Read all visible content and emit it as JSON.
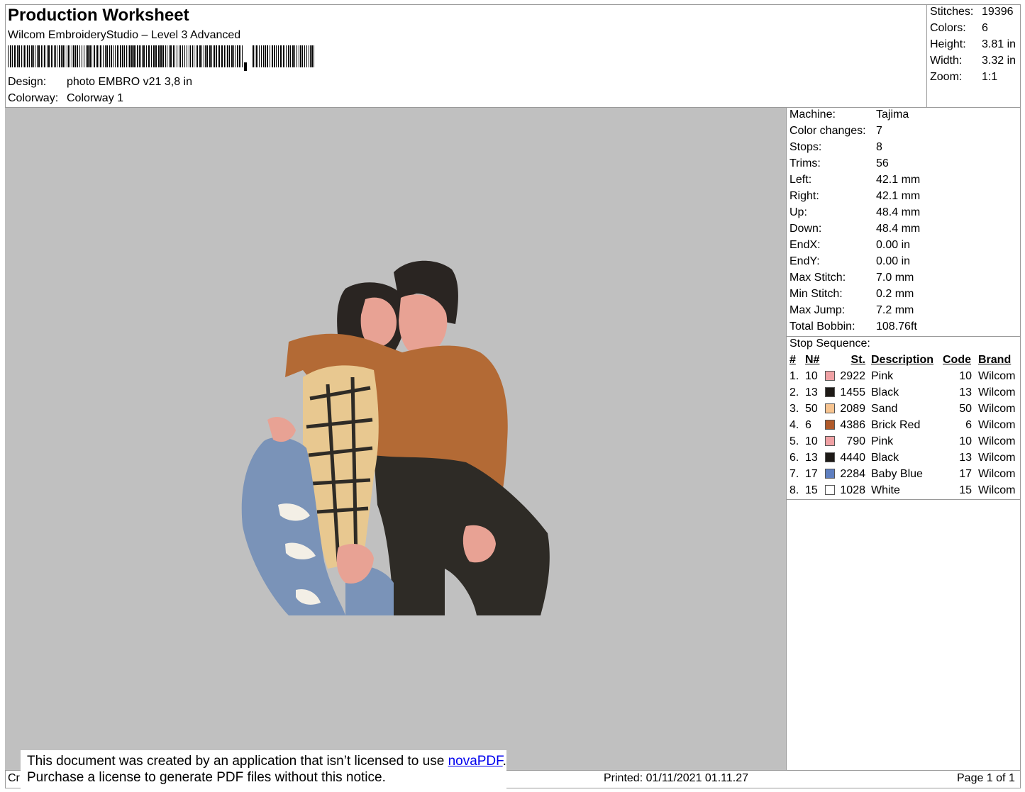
{
  "header": {
    "title": "Production Worksheet",
    "subtitle": "Wilcom EmbroideryStudio – Level 3 Advanced",
    "barcode_icon": "barcode-icon",
    "design_label": "Design:",
    "design_value": "photo EMBRO v21 3,8 in",
    "colorway_label": "Colorway:",
    "colorway_value": "Colorway 1"
  },
  "stats": [
    {
      "label": "Stitches:",
      "value": "19396"
    },
    {
      "label": "Colors:",
      "value": "6"
    },
    {
      "label": "Height:",
      "value": "3.81 in"
    },
    {
      "label": "Width:",
      "value": "3.32 in"
    },
    {
      "label": "Zoom:",
      "value": "1:1"
    }
  ],
  "machine_info": [
    {
      "label": "Machine:",
      "value": "Tajima"
    },
    {
      "label": "Color changes:",
      "value": "7"
    },
    {
      "label": "Stops:",
      "value": "8"
    },
    {
      "label": "Trims:",
      "value": "56"
    },
    {
      "label": "Left:",
      "value": "42.1 mm"
    },
    {
      "label": "Right:",
      "value": "42.1 mm"
    },
    {
      "label": "Up:",
      "value": "48.4 mm"
    },
    {
      "label": "Down:",
      "value": "48.4 mm"
    },
    {
      "label": "EndX:",
      "value": "0.00 in"
    },
    {
      "label": "EndY:",
      "value": "0.00 in"
    },
    {
      "label": "Max Stitch:",
      "value": "7.0 mm"
    },
    {
      "label": "Min Stitch:",
      "value": "0.2 mm"
    },
    {
      "label": "Max Jump:",
      "value": "7.2 mm"
    },
    {
      "label": "Total Bobbin:",
      "value": "108.76ft"
    }
  ],
  "stop_sequence": {
    "title": "Stop Sequence:",
    "headers": {
      "num": "#",
      "n": "N#",
      "st": "St.",
      "description": "Description",
      "code": "Code",
      "brand": "Brand"
    },
    "rows": [
      {
        "num": "1.",
        "n": "10",
        "color": "#f0a1a4",
        "st": "2922",
        "description": "Pink",
        "code": "10",
        "brand": "Wilcom"
      },
      {
        "num": "2.",
        "n": "13",
        "color": "#1e1a17",
        "st": "1455",
        "description": "Black",
        "code": "13",
        "brand": "Wilcom"
      },
      {
        "num": "3.",
        "n": "50",
        "color": "#f7c490",
        "st": "2089",
        "description": "Sand",
        "code": "50",
        "brand": "Wilcom"
      },
      {
        "num": "4.",
        "n": "6",
        "color": "#b05a2a",
        "st": "4386",
        "description": "Brick Red",
        "code": "6",
        "brand": "Wilcom"
      },
      {
        "num": "5.",
        "n": "10",
        "color": "#f0a1a4",
        "st": "790",
        "description": "Pink",
        "code": "10",
        "brand": "Wilcom"
      },
      {
        "num": "6.",
        "n": "13",
        "color": "#1e1a17",
        "st": "4440",
        "description": "Black",
        "code": "13",
        "brand": "Wilcom"
      },
      {
        "num": "7.",
        "n": "17",
        "color": "#5f7fc0",
        "st": "2284",
        "description": "Baby Blue",
        "code": "17",
        "brand": "Wilcom"
      },
      {
        "num": "8.",
        "n": "15",
        "color": "#ffffff",
        "st": "1028",
        "description": "White",
        "code": "15",
        "brand": "Wilcom"
      }
    ]
  },
  "footer": {
    "created_prefix": "Cr",
    "printed": "Printed: 01/11/2021 01.11.27",
    "page": "Page 1 of 1",
    "notice_line1_a": "This document was created by an application that isn’t licensed to use ",
    "notice_link": "novaPDF",
    "notice_line1_b": ".",
    "notice_line2": "Purchase a license to generate PDF files without this notice."
  }
}
